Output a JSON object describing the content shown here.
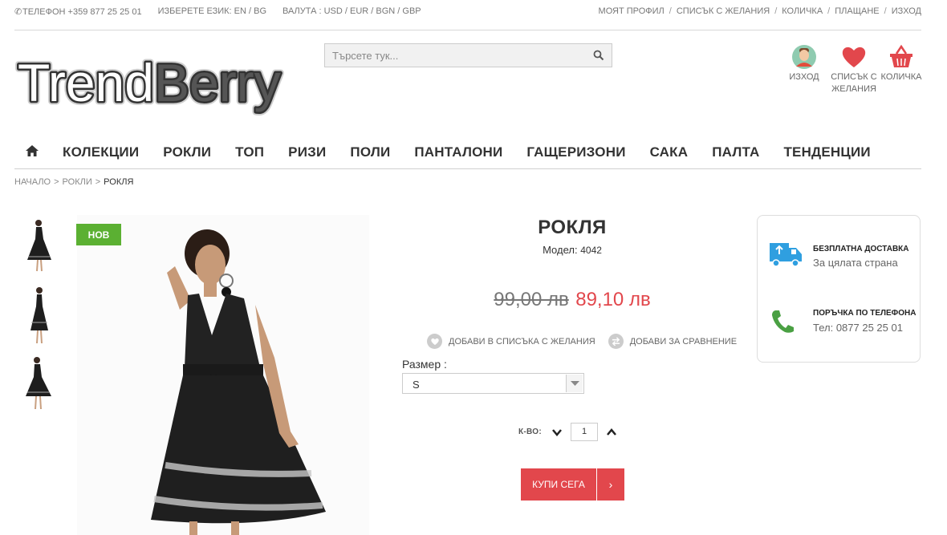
{
  "topbar": {
    "phone": "ТЕЛЕФОН +359 877 25 25 01",
    "language": "ИЗБЕРЕТЕ ЕЗИК: EN / BG",
    "currency": "ВАЛУТА : USD / EUR / BGN / GBP",
    "links": [
      "МОЯТ ПРОФИЛ",
      "СПИСЪК С ЖЕЛАНИЯ",
      "КОЛИЧКА",
      "ПЛАЩАНЕ",
      "ИЗХОД"
    ]
  },
  "logo": {
    "text": "TrendBerry"
  },
  "search": {
    "placeholder": "Търсете тук..."
  },
  "header_icons": {
    "logout": "ИЗХОД",
    "wishlist_line1": "СПИСЪК С",
    "wishlist_line2": "ЖЕЛАНИЯ",
    "cart": "КОЛИЧКА"
  },
  "nav": {
    "items": [
      "КОЛЕКЦИИ",
      "РОКЛИ",
      "ТОП",
      "РИЗИ",
      "ПОЛИ",
      "ПАНТАЛОНИ",
      "ГАЩЕРИЗОНИ",
      "САКА",
      "ПАЛТА",
      "ТЕНДЕНЦИИ"
    ]
  },
  "breadcrumb": {
    "items": [
      "НАЧАЛО",
      "РОКЛИ",
      "РОКЛЯ"
    ],
    "separator": ">"
  },
  "product": {
    "badge": "НОВ",
    "title": "РОКЛЯ",
    "model_label": "Модел:",
    "model_value": "4042",
    "old_price": "99,00 лв",
    "new_price": "89,10 лв",
    "add_wishlist": "ДОБАВИ В СПИСЪКА С ЖЕЛАНИЯ",
    "add_compare": "ДОБАВИ ЗА СРАВНЕНИЕ",
    "size_label": "Размер :",
    "size_value": "S",
    "qty_label": "К-ВО:",
    "qty_value": "1",
    "buy_label": "КУПИ СЕГА",
    "buy_arrow": "›"
  },
  "info": {
    "delivery_title": "БЕЗПЛАТНА ДОСТАВКА",
    "delivery_text": "За цялата страна",
    "phone_title": "ПОРЪЧКА ПО ТЕЛЕФОНА",
    "phone_text": "Тел: 0877 25 25 01"
  },
  "colors": {
    "accent_red": "#e2474c",
    "badge_green": "#5bb032",
    "truck_blue": "#2f9fe0",
    "phone_green": "#4aa043"
  }
}
